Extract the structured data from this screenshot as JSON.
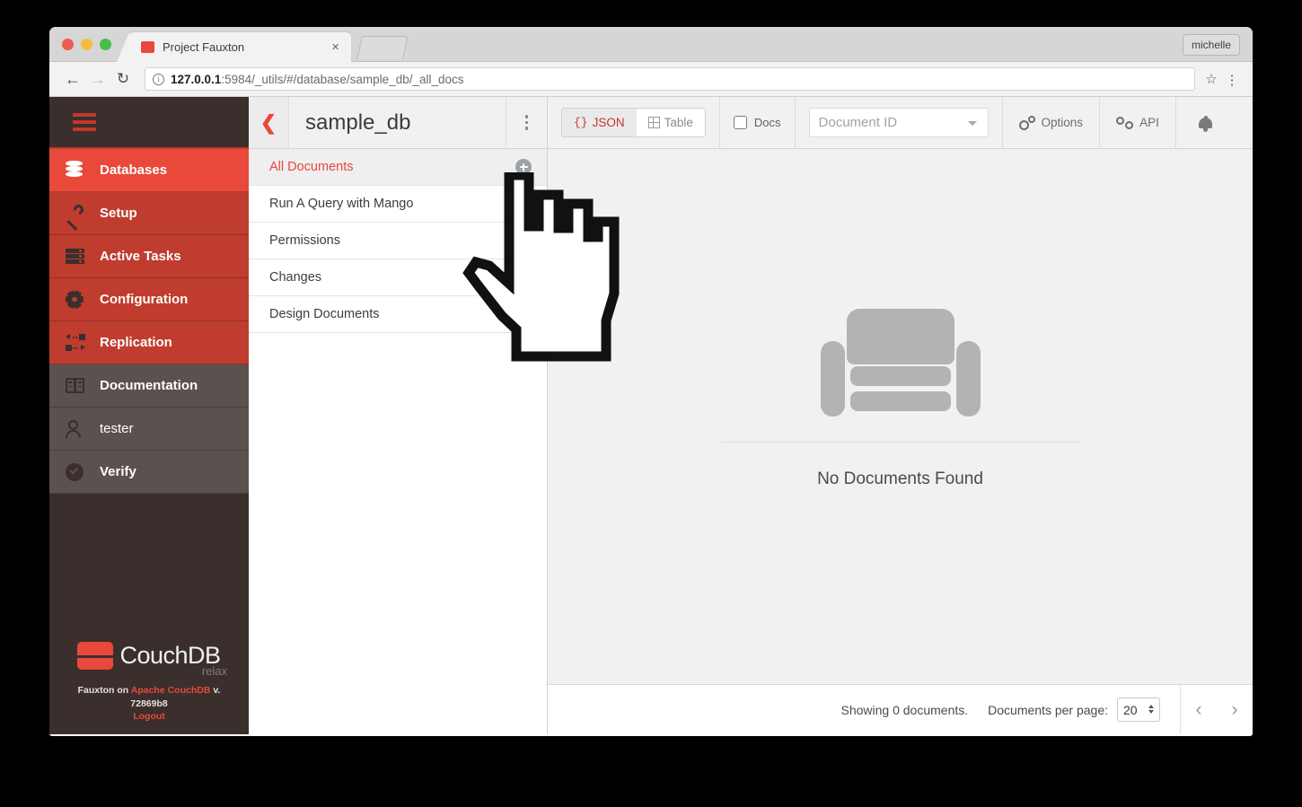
{
  "browser": {
    "tab": {
      "title": "Project Fauxton",
      "favicon": "couch-icon",
      "close_label": "×"
    },
    "profile": "michelle",
    "nav": {
      "back": "←",
      "forward": "→",
      "reload": "↻",
      "star": "☆",
      "menu": "⋮"
    },
    "url": {
      "host": "127.0.0.1",
      "rest": ":5984/_utils/#/database/sample_db/_all_docs",
      "info_icon": "info-icon"
    }
  },
  "sidebar": {
    "hamburger": "menu-icon",
    "items": [
      {
        "label": "Databases",
        "icon": "database-icon",
        "state": "active"
      },
      {
        "label": "Setup",
        "icon": "wrench-icon",
        "state": "red"
      },
      {
        "label": "Active Tasks",
        "icon": "tasks-icon",
        "state": "red"
      },
      {
        "label": "Configuration",
        "icon": "gear-icon",
        "state": "red"
      },
      {
        "label": "Replication",
        "icon": "replication-icon",
        "state": "red"
      },
      {
        "label": "Documentation",
        "icon": "book-icon",
        "state": "grey"
      },
      {
        "label": "tester",
        "icon": "user-icon",
        "state": "grey"
      },
      {
        "label": "Verify",
        "icon": "check-circle-icon",
        "state": "grey"
      }
    ],
    "footer": {
      "brand": "CouchDB",
      "tagline": "relax",
      "built_prefix": "Fauxton on ",
      "built_link": "Apache CouchDB",
      "built_version": " v. 72869b8",
      "logout": "Logout"
    }
  },
  "dbpanel": {
    "back_icon": "chevron-left-icon",
    "title": "sample_db",
    "kebab_icon": "more-vertical-icon",
    "rows": [
      {
        "label": "All Documents",
        "selected": true,
        "badge": "add-icon"
      },
      {
        "label": "Run A Query with Mango",
        "selected": false,
        "badge": ""
      },
      {
        "label": "Permissions",
        "selected": false,
        "badge": ""
      },
      {
        "label": "Changes",
        "selected": false,
        "badge": ""
      },
      {
        "label": "Design Documents",
        "selected": false,
        "badge": ""
      }
    ]
  },
  "toolbar": {
    "view_json": "JSON",
    "view_json_prefix": "{}",
    "view_table": "Table",
    "docs_label": "Docs",
    "docid_placeholder": "Document ID",
    "options_label": "Options",
    "api_label": "API",
    "bell_icon": "bell-icon"
  },
  "empty_state": {
    "illustration": "couch-illustration",
    "message": "No Documents Found"
  },
  "footbar": {
    "showing": "Showing 0 documents.",
    "per_page_label": "Documents per page:",
    "per_page_value": "20",
    "prev": "‹",
    "next": "›"
  },
  "colors": {
    "brand_red": "#e8493b",
    "sidebar_dark": "#3a2f2c",
    "nav_red": "#bf3c2e",
    "nav_grey": "#5b514e",
    "couch_grey": "#b3b3b3"
  }
}
